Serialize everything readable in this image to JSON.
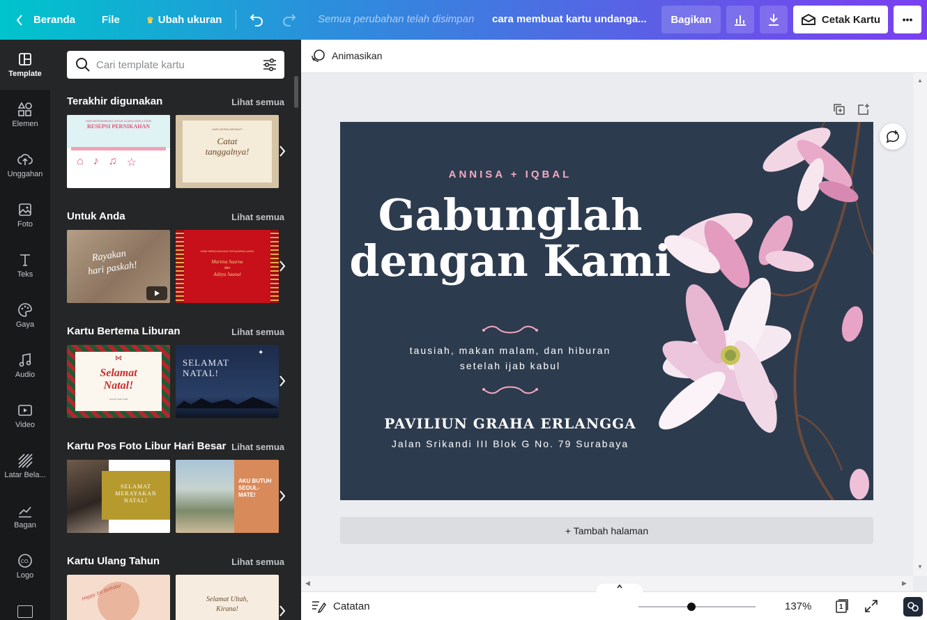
{
  "topbar": {
    "home_label": "Beranda",
    "file_label": "File",
    "resize_label": "Ubah ukuran",
    "saved_status": "Semua perubahan telah disimpan",
    "doc_title": "cara membuat kartu undanga...",
    "share_label": "Bagikan",
    "print_label": "Cetak Kartu",
    "more_label": "•••"
  },
  "rail": [
    {
      "label": "Template"
    },
    {
      "label": "Elemen"
    },
    {
      "label": "Unggahan"
    },
    {
      "label": "Foto"
    },
    {
      "label": "Teks"
    },
    {
      "label": "Gaya"
    },
    {
      "label": "Audio"
    },
    {
      "label": "Video"
    },
    {
      "label": "Latar Bela..."
    },
    {
      "label": "Bagan"
    },
    {
      "label": "Logo"
    }
  ],
  "panel": {
    "search_placeholder": "Cari template kartu",
    "see_all": "Lihat semua",
    "sections": [
      {
        "title": "Terakhir digunakan",
        "thumbs": [
          {
            "lines": [
              "HARI BERSAMBUNG UNTUK ACARA DEBI & DION",
              "RESEPSI PERNIKAHAN"
            ]
          },
          {
            "lines": [
              "HARI DEPAN MENANTI",
              "Catat",
              "tanggalnya!"
            ]
          }
        ]
      },
      {
        "title": "Untuk Anda",
        "thumbs": [
          {
            "lines": [
              "Rayakan",
              "hari paskah!"
            ]
          },
          {
            "lines": [
              "KAMI MENGUNDANG KEHADIRAN ANDA",
              "Martina Saurna",
              "dan",
              "Aditya Saanul"
            ]
          }
        ]
      },
      {
        "title": "Kartu Bertema Liburan",
        "thumbs": [
          {
            "lines": [
              "Selamat",
              "Natal!",
              "SALAM DARI KAMI"
            ]
          },
          {
            "lines": [
              "SELAMAT",
              "NATAL!"
            ]
          }
        ]
      },
      {
        "title": "Kartu Pos Foto Libur Hari Besar",
        "thumbs": [
          {
            "lines": [
              "SELAMAT",
              "MERAYAKAN",
              "NATAL!"
            ]
          },
          {
            "lines": [
              "AKU BUTUH",
              "SEOUL-",
              "MATE!"
            ]
          }
        ]
      },
      {
        "title": "Kartu Ulang Tahun",
        "thumbs": [
          {
            "lines": [
              "Happy 1st Birthday"
            ]
          },
          {
            "lines": [
              "Selamat Ultah,",
              "Kirana!"
            ]
          }
        ]
      }
    ]
  },
  "subbar": {
    "animate_label": "Animasikan"
  },
  "card": {
    "couple": "ANNISA + IQBAL",
    "headline_1": "Gabunglah",
    "headline_2": "dengan Kami",
    "desc_1": "tausiah, makan malam, dan hiburan",
    "desc_2": "setelah ijab kabul",
    "venue": "PAVILIUN GRAHA ERLANGGA",
    "address": "Jalan Srikandi III Blok G No. 79 Surabaya",
    "bg_color": "#2d3b4e",
    "accent_color": "#f4a9c2"
  },
  "canvas": {
    "add_page_label": "+ Tambah halaman"
  },
  "bottombar": {
    "notes_label": "Catatan",
    "zoom_label": "137%",
    "zoom_level": 0.45,
    "page_count": "1"
  }
}
